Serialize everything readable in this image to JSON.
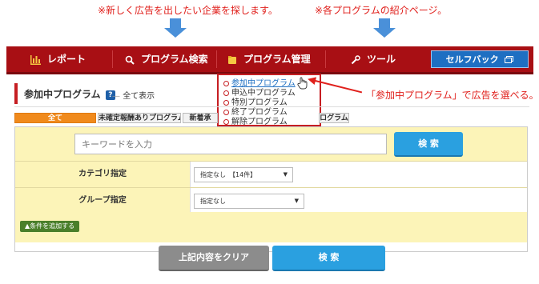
{
  "annotations": {
    "note_left": "※新しく広告を出したい企業を探します。",
    "note_right": "※各プログラムの紹介ページ。",
    "note_dropdown": "「参加中プログラム」で広告を選べる。"
  },
  "nav": {
    "items": [
      {
        "label": "レポート",
        "icon": "bar-chart-icon"
      },
      {
        "label": "プログラム検索",
        "icon": "search-icon"
      },
      {
        "label": "プログラム管理",
        "icon": "folder-icon"
      },
      {
        "label": "ツール",
        "icon": "wrench-icon"
      }
    ],
    "self_back_label": "セルフバック",
    "self_back_icon": "window-icon"
  },
  "dropdown": {
    "items": [
      "参加中プログラム",
      "申込中プログラム",
      "特別プログラム",
      "終了プログラム",
      "解除プログラム"
    ],
    "active_index": 0
  },
  "page": {
    "title": "参加中プログラム",
    "help_icon": "?",
    "subtitle": "全て表示"
  },
  "tabs": [
    "全て",
    "未確定報酬ありプログラム",
    "新着承",
    "ログラム"
  ],
  "search": {
    "keyword_placeholder": "キーワードを入力",
    "search_button": "検 索",
    "category_label": "カテゴリ指定",
    "category_value": "指定なし　【14件】",
    "group_label": "グループ指定",
    "group_value": "指定なし",
    "add_condition": "▲条件を追加する",
    "clear_button": "上記内容をクリア",
    "bottom_search_button": "検 索"
  },
  "colors": {
    "nav_bg": "#a80f14",
    "accent_blue": "#2aa0e0",
    "panel_yellow": "#fcf4b8",
    "note_red": "#e0201c",
    "tab_active": "#f08a1c"
  }
}
